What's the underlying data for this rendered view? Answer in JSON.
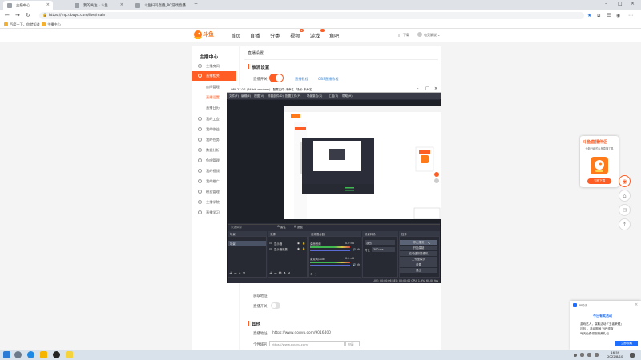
{
  "browser": {
    "tabs": [
      {
        "label": "主播中心",
        "active": true
      },
      {
        "label": "我的关注 - 斗鱼",
        "active": false
      },
      {
        "label": "斗鱼扫码直播_PC游戏直播",
        "active": false
      }
    ],
    "url": "https://mp.douyu.com/live/main",
    "bookmarks": [
      "百度一下，你就知道",
      "主播中心"
    ]
  },
  "site": {
    "logo_text": "斗鱼",
    "nav": [
      "首页",
      "直播",
      "分类",
      "视频",
      "游戏",
      "鱼吧"
    ],
    "nav_badge": "9",
    "header_right": [
      "下载",
      "电竞解说"
    ]
  },
  "sidebar": {
    "title": "主播中心",
    "items": [
      {
        "label": "主播房间"
      },
      {
        "label": "直播相关",
        "active": true
      },
      {
        "label": "房间管理"
      },
      {
        "label": "直播设置",
        "active_sub": true
      },
      {
        "label": "直播日历"
      },
      {
        "label": "我的工会"
      },
      {
        "label": "我的收益"
      },
      {
        "label": "我的任务"
      },
      {
        "label": "数据分析"
      },
      {
        "label": "鱼吧管理"
      },
      {
        "label": "我的视频"
      },
      {
        "label": "我的推广"
      },
      {
        "label": "粉丝管理"
      },
      {
        "label": "主播学院"
      },
      {
        "label": "直播学习"
      }
    ]
  },
  "main": {
    "page_title": "直播设置",
    "section_basic": "推流设置",
    "live_toggle_label": "直播开关",
    "links": [
      "直播教程",
      "OBS直播教程"
    ],
    "extra_label": "获取地址",
    "auto_label": "直播开关",
    "section_other": "其他",
    "room_label": "直播地址：",
    "room_url": "https://www.douyu.com/9016400",
    "short_label": "个性域名：",
    "short_value": "https://www.douyu.com/",
    "short_btn": "申请"
  },
  "obs": {
    "title": "OBS 27.0.1 (64-bit, windows) - 配置文件: 未命名 - 场景: 未命名",
    "menu": [
      "文件(F)",
      "编辑(E)",
      "视图(V)",
      "停靠部件(D)",
      "配置文件(P)",
      "场景集合(S)",
      "工具(T)",
      "帮助(H)"
    ],
    "toolbar": [
      "未选择源",
      "属性",
      "滤镜"
    ],
    "docks": {
      "scenes": {
        "title": "场景",
        "items": [
          "场景"
        ]
      },
      "sources": {
        "title": "来源",
        "items": [
          "显示器",
          "显示器采集"
        ]
      },
      "mixer": {
        "title": "音频混合器",
        "tracks": [
          "桌面音频",
          "麦克风/Aux"
        ],
        "db": [
          "0.0 dB",
          "0.0 dB"
        ]
      },
      "transitions": {
        "title": "场景转场",
        "type": "淡出",
        "duration_label": "时长",
        "duration": "300 ms"
      },
      "controls": {
        "title": "控件",
        "buttons": [
          "停止推流",
          "开始录制",
          "启动虚拟摄像机",
          "工作室模式",
          "设置",
          "退出"
        ]
      }
    },
    "status": "LIVE: 00:00:06  REC: 00:00:00  CPU: 1.9%, 60.00 fps"
  },
  "promo": {
    "title": "斗鱼直播伴侣",
    "subtitle": "全新升级的斗鱼直播工具",
    "button": "立即下载"
  },
  "notify": {
    "app": "PP助手",
    "title": "今日有奖活动",
    "lines": [
      "游戏达人，赢取活动「王者荣耀」",
      "礼包 ，活动期间 VIP 领取",
      "每天免费领取精美礼包"
    ],
    "button": "立即领取"
  },
  "taskbar": {
    "time": "16:59",
    "date": "2022/8/10"
  },
  "colors": {
    "accent": "#ff5d23",
    "link": "#3a86d6",
    "obs_bg": "#2b2e38"
  }
}
